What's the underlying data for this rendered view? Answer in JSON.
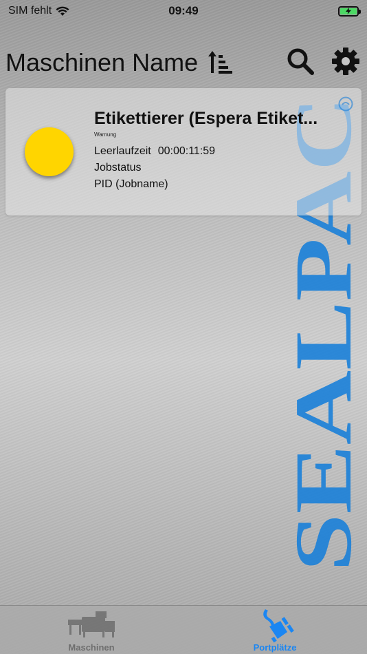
{
  "status_bar": {
    "carrier": "SIM fehlt",
    "time": "09:49",
    "battery_percent": 100
  },
  "nav": {
    "title": "Maschinen Name"
  },
  "machines": [
    {
      "name": "Etikettierer (Espera Etiket...",
      "status_label": "Warnung",
      "status_color": "#ffd500",
      "idle_label": "Leerlaufzeit",
      "idle_time": "00:00:11:59",
      "job_status": "Jobstatus",
      "pid": "PID (Jobname)"
    }
  ],
  "watermark": {
    "text": "SEALPAC",
    "color": "#1a7fd8"
  },
  "tabs": [
    {
      "label": "Maschinen",
      "icon": "machine-icon",
      "active": false
    },
    {
      "label": "Portplätze",
      "icon": "plug-icon",
      "active": true
    }
  ],
  "colors": {
    "accent": "#1b86f2",
    "inactive_tab": "#6e6e6e",
    "warning": "#ffd500"
  }
}
